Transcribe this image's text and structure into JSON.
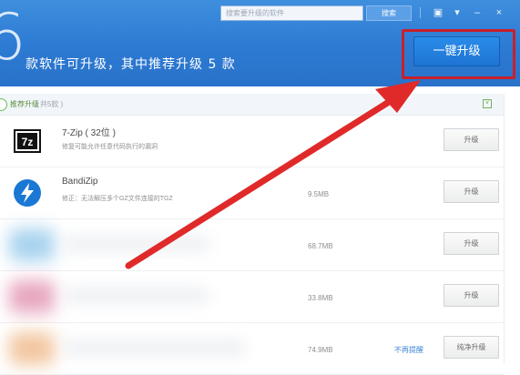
{
  "header": {
    "big_number": "6",
    "summary": "款软件可升级，其中推荐升级 5 款",
    "search_placeholder": "搜索要升级的软件",
    "search_button": "搜索",
    "upgrade_all_label": "一键升级"
  },
  "window_controls": [
    {
      "name": "skin-icon",
      "glyph": "▣"
    },
    {
      "name": "menu-icon",
      "glyph": "▾"
    },
    {
      "name": "minimize-icon",
      "glyph": "–"
    },
    {
      "name": "close-icon",
      "glyph": "×"
    }
  ],
  "section": {
    "label": "推荐升级",
    "count": "( 共5款 )",
    "collapse_glyph": "˅"
  },
  "rows": [
    {
      "name": "7-Zip ( 32位 )",
      "desc": "修复可能允许任意代码执行的漏洞",
      "size": "",
      "button": "升级",
      "ignore": "",
      "icon": "7zip-icon"
    },
    {
      "name": "BandiZip",
      "desc": "修正：无法解压多个GZ文件连接的TGZ",
      "size": "9.5MB",
      "button": "升级",
      "ignore": "",
      "icon": "bandizip-icon"
    },
    {
      "name": "",
      "desc": "",
      "size": "68.7MB",
      "button": "升级",
      "ignore": "",
      "icon": "blurred-icon",
      "blur": "#a9d3ef"
    },
    {
      "name": "",
      "desc": "",
      "size": "33.8MB",
      "button": "升级",
      "ignore": "",
      "icon": "blurred-icon",
      "blur": "#e7a7c0"
    },
    {
      "name": "",
      "desc": "",
      "size": "74.9MB",
      "button": "纯净升级",
      "ignore": "不再提醒",
      "icon": "blurred-icon",
      "blur": "#f3c7a2"
    }
  ],
  "colors": {
    "header_blue": "#2c7ad3",
    "highlight_red": "#c8202b",
    "arrow_red": "#e02a2a"
  }
}
